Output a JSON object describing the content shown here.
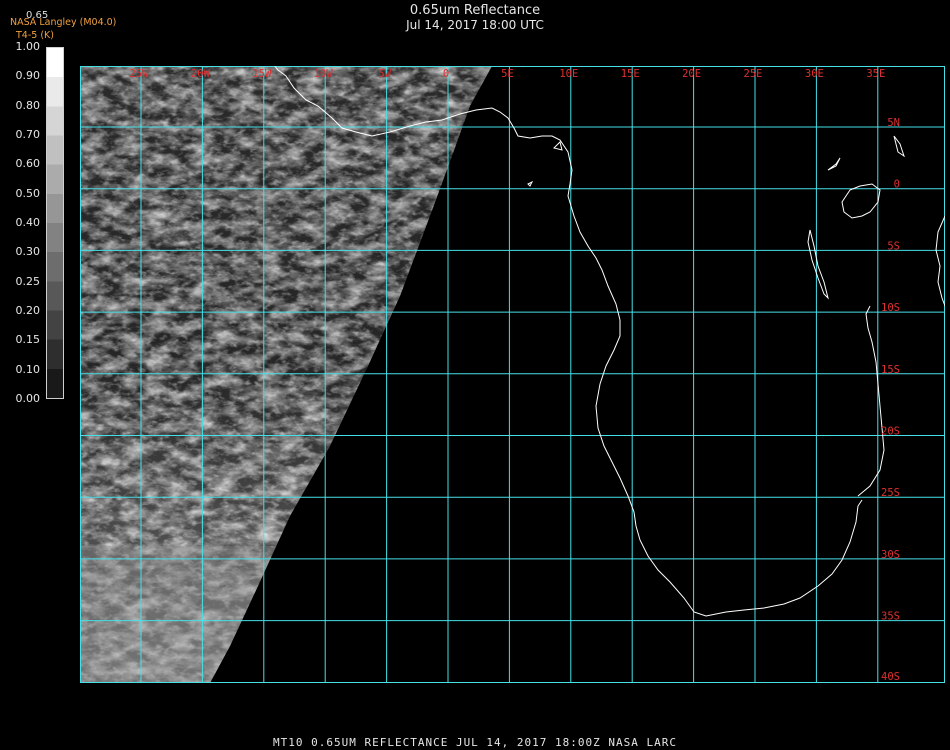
{
  "header": {
    "title": "0.65um Reflectance",
    "datetime": "Jul 14, 2017 18:00 UTC"
  },
  "badge": {
    "line1": "NASA Langley (M04.0)",
    "line2": "T4-5 (K)"
  },
  "scale_label": "0.65",
  "colorbar": {
    "ticks": [
      "1.00",
      "0.90",
      "0.80",
      "0.70",
      "0.60",
      "0.50",
      "0.40",
      "0.30",
      "0.25",
      "0.20",
      "0.15",
      "0.10",
      "0.00"
    ],
    "min": 0.0,
    "max": 1.0
  },
  "map": {
    "lon_labels": [
      "25W",
      "20W",
      "15W",
      "10W",
      "5W",
      "0",
      "5E",
      "10E",
      "15E",
      "20E",
      "25E",
      "30E",
      "35E"
    ],
    "lat_labels": [
      "5N",
      "0",
      "5S",
      "10S",
      "15S",
      "20S",
      "25S",
      "30S",
      "35S",
      "40S"
    ],
    "grid_color": "#46e0e8",
    "label_color": "#e03030",
    "coast_color": "#ffffff"
  },
  "footer": "MT10  0.65UM REFLECTANCE   JUL 14, 2017 18:00Z   NASA LARC"
}
